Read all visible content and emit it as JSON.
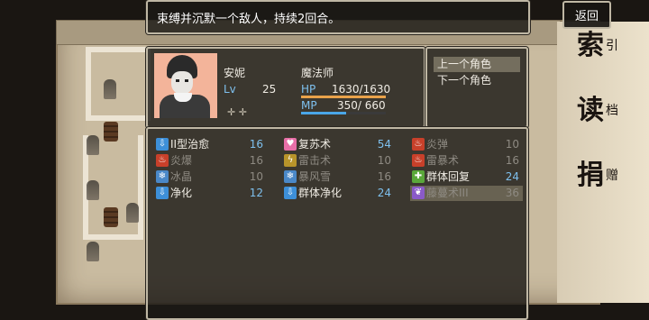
{
  "help": {
    "text": "束缚并沉默一个敌人，持续2回合。"
  },
  "back_button": {
    "label": "返回"
  },
  "side_menu": [
    {
      "big": "索",
      "small": "引"
    },
    {
      "big": "读",
      "small": "档"
    },
    {
      "big": "捐",
      "small": "赠"
    }
  ],
  "actor": {
    "name": "安妮",
    "class": "魔法师",
    "level_label": "Lv",
    "level": "25",
    "hp_label": "HP",
    "hp_text": "1630/1630",
    "hp_ratio": 1.0,
    "mp_label": "MP",
    "mp_text": "350/ 660",
    "mp_ratio": 0.53
  },
  "nav": {
    "prev": "上一个角色",
    "next": "下一个角色"
  },
  "colors": {
    "hp_bar": "#e9a24a",
    "mp_bar": "#4aa6e8",
    "cost": "#7ec0ee"
  },
  "skills": [
    {
      "name": "II型治愈",
      "cost": "16",
      "icon": "heal-icon",
      "icon_color": "#3d8fd8",
      "glyph": "⇩",
      "enabled": true
    },
    {
      "name": "复苏术",
      "cost": "54",
      "icon": "heart-icon",
      "icon_color": "#e86fa8",
      "glyph": "♥",
      "enabled": true
    },
    {
      "name": "炎弹",
      "cost": "10",
      "icon": "fire-icon",
      "icon_color": "#c8402a",
      "glyph": "♨",
      "enabled": false
    },
    {
      "name": "炎爆",
      "cost": "16",
      "icon": "fire-icon",
      "icon_color": "#c8402a",
      "glyph": "♨",
      "enabled": false
    },
    {
      "name": "雷击术",
      "cost": "10",
      "icon": "thunder-icon",
      "icon_color": "#b8942a",
      "glyph": "ϟ",
      "enabled": false
    },
    {
      "name": "雷暴术",
      "cost": "16",
      "icon": "fire-icon",
      "icon_color": "#c8402a",
      "glyph": "♨",
      "enabled": false
    },
    {
      "name": "冰晶",
      "cost": "10",
      "icon": "ice-icon",
      "icon_color": "#4a88c8",
      "glyph": "❄",
      "enabled": false
    },
    {
      "name": "暴风雪",
      "cost": "16",
      "icon": "ice-icon",
      "icon_color": "#4a88c8",
      "glyph": "❄",
      "enabled": false
    },
    {
      "name": "群体回复",
      "cost": "24",
      "icon": "group-heal-icon",
      "icon_color": "#5aa83a",
      "glyph": "✚",
      "enabled": true
    },
    {
      "name": "净化",
      "cost": "12",
      "icon": "heal-icon",
      "icon_color": "#3d8fd8",
      "glyph": "⇩",
      "enabled": true
    },
    {
      "name": "群体净化",
      "cost": "24",
      "icon": "heal-icon",
      "icon_color": "#3d8fd8",
      "glyph": "⇩",
      "enabled": true
    },
    {
      "name": "藤蔓术III",
      "cost": "36",
      "icon": "vine-icon",
      "icon_color": "#8a5ac8",
      "glyph": "❦",
      "enabled": false,
      "selected": true
    }
  ]
}
